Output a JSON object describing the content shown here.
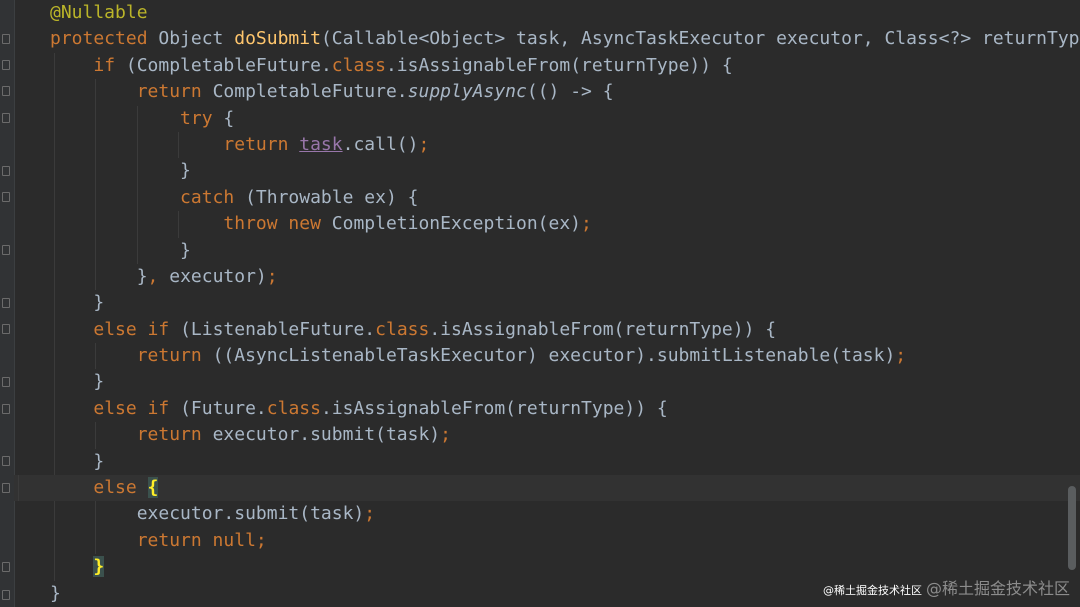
{
  "editor": {
    "lines": [
      [
        {
          "t": "@Nullable",
          "c": "ann"
        }
      ],
      [
        {
          "t": "protected ",
          "c": "kw"
        },
        {
          "t": "Object "
        },
        {
          "t": "doSubmit",
          "c": "fn"
        },
        {
          "t": "(Callable<Object> task, AsyncTaskExecutor executor, Class<?> returnType) {"
        }
      ],
      [
        {
          "t": "    "
        },
        {
          "t": "if ",
          "c": "kw"
        },
        {
          "t": "(CompletableFuture."
        },
        {
          "t": "class",
          "c": "kw"
        },
        {
          "t": ".isAssignableFrom(returnType)) {"
        }
      ],
      [
        {
          "t": "        "
        },
        {
          "t": "return ",
          "c": "kw"
        },
        {
          "t": "CompletableFuture."
        },
        {
          "t": "supplyAsync",
          "c": "it"
        },
        {
          "t": "(() -> {"
        }
      ],
      [
        {
          "t": "            "
        },
        {
          "t": "try ",
          "c": "kw"
        },
        {
          "t": "{"
        }
      ],
      [
        {
          "t": "                "
        },
        {
          "t": "return ",
          "c": "kw"
        },
        {
          "t": "task",
          "c": "field"
        },
        {
          "t": ".call()"
        },
        {
          "t": ";",
          "c": "kw"
        }
      ],
      [
        {
          "t": "            }"
        }
      ],
      [
        {
          "t": "            "
        },
        {
          "t": "catch ",
          "c": "kw"
        },
        {
          "t": "(Throwable ex) {"
        }
      ],
      [
        {
          "t": "                "
        },
        {
          "t": "throw new ",
          "c": "kw"
        },
        {
          "t": "CompletionException(ex)"
        },
        {
          "t": ";",
          "c": "kw"
        }
      ],
      [
        {
          "t": "            }"
        }
      ],
      [
        {
          "t": "        }"
        },
        {
          "t": ", ",
          "c": "kw"
        },
        {
          "t": "executor)"
        },
        {
          "t": ";",
          "c": "kw"
        }
      ],
      [
        {
          "t": "    }"
        }
      ],
      [
        {
          "t": "    "
        },
        {
          "t": "else if ",
          "c": "kw"
        },
        {
          "t": "(ListenableFuture."
        },
        {
          "t": "class",
          "c": "kw"
        },
        {
          "t": ".isAssignableFrom(returnType)) {"
        }
      ],
      [
        {
          "t": "        "
        },
        {
          "t": "return ",
          "c": "kw"
        },
        {
          "t": "((AsyncListenableTaskExecutor) executor).submitListenable(task)"
        },
        {
          "t": ";",
          "c": "kw"
        }
      ],
      [
        {
          "t": "    }"
        }
      ],
      [
        {
          "t": "    "
        },
        {
          "t": "else if ",
          "c": "kw"
        },
        {
          "t": "(Future."
        },
        {
          "t": "class",
          "c": "kw"
        },
        {
          "t": ".isAssignableFrom(returnType)) {"
        }
      ],
      [
        {
          "t": "        "
        },
        {
          "t": "return ",
          "c": "kw"
        },
        {
          "t": "executor.submit(task)"
        },
        {
          "t": ";",
          "c": "kw"
        }
      ],
      [
        {
          "t": "    }"
        }
      ],
      [
        {
          "t": "    "
        },
        {
          "t": "else ",
          "c": "kw"
        },
        {
          "t": "{",
          "c": "brace-hl"
        }
      ],
      [
        {
          "t": "        executor.submit(task)"
        },
        {
          "t": ";",
          "c": "kw"
        }
      ],
      [
        {
          "t": "        "
        },
        {
          "t": "return null",
          "c": "kw"
        },
        {
          "t": ";",
          "c": "kw"
        }
      ],
      [
        {
          "t": "    "
        },
        {
          "t": "}",
          "c": "brace-hl"
        }
      ],
      [
        {
          "t": "}"
        }
      ]
    ],
    "current_line": 18
  },
  "watermark": {
    "small": "@稀土掘金技术社区",
    "text": "@稀土掘金技术社区"
  }
}
